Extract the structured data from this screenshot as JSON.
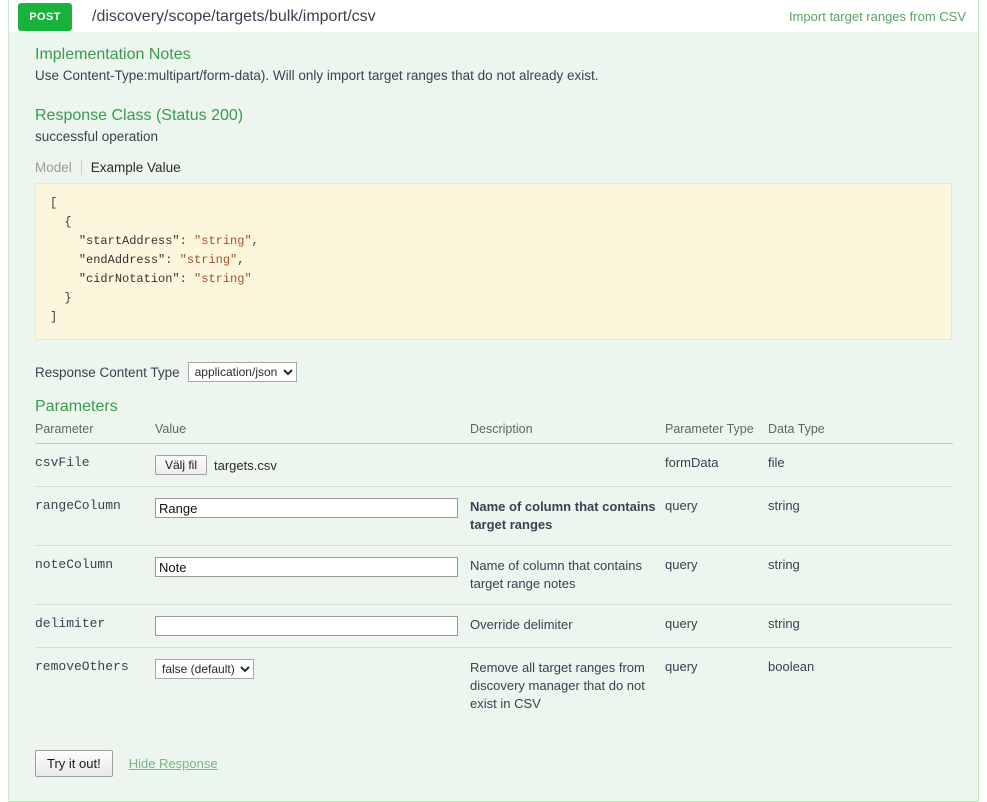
{
  "operation": {
    "method": "POST",
    "path": "/discovery/scope/targets/bulk/import/csv",
    "summary": "Import target ranges from CSV",
    "method_color": "#19b23c"
  },
  "notes": {
    "title": "Implementation Notes",
    "text": "Use Content-Type:multipart/form-data). Will only import target ranges that do not already exist."
  },
  "response_class": {
    "title": "Response Class (Status 200)",
    "description": "successful operation",
    "tabs": [
      {
        "label": "Model",
        "active": false
      },
      {
        "label": "Example Value",
        "active": true
      }
    ],
    "example_value": {
      "open_bracket": "[",
      "open_brace": "  {",
      "fields": [
        {
          "key": "\"startAddress\"",
          "value": "\"string\"",
          "comma": ","
        },
        {
          "key": "\"endAddress\"",
          "value": "\"string\"",
          "comma": ","
        },
        {
          "key": "\"cidrNotation\"",
          "value": "\"string\"",
          "comma": ""
        }
      ],
      "close_brace": "  }",
      "close_bracket": "]"
    }
  },
  "content_type": {
    "label": "Response Content Type",
    "selected": "application/json",
    "options": [
      "application/json"
    ]
  },
  "parameters": {
    "title": "Parameters",
    "columns": [
      "Parameter",
      "Value",
      "Description",
      "Parameter Type",
      "Data Type"
    ],
    "rows": [
      {
        "name": "csvFile",
        "control": "file",
        "file_button_label": "Välj fil",
        "file_name": "targets.csv",
        "value": "",
        "placeholder": "",
        "description": "",
        "required": false,
        "parameter_type": "formData",
        "data_type": "file"
      },
      {
        "name": "rangeColumn",
        "control": "text",
        "value": "Range",
        "placeholder": "",
        "description": "Name of column that contains target ranges",
        "required": true,
        "parameter_type": "query",
        "data_type": "string"
      },
      {
        "name": "noteColumn",
        "control": "text",
        "value": "Note",
        "placeholder": "",
        "description": "Name of column that contains target range notes",
        "required": false,
        "parameter_type": "query",
        "data_type": "string"
      },
      {
        "name": "delimiter",
        "control": "text",
        "value": "",
        "placeholder": "",
        "description": "Override delimiter",
        "required": false,
        "parameter_type": "query",
        "data_type": "string"
      },
      {
        "name": "removeOthers",
        "control": "select",
        "value": "false (default)",
        "options": [
          "false (default)",
          "true"
        ],
        "description": "Remove all target ranges from discovery manager that do not exist in CSV",
        "required": false,
        "parameter_type": "query",
        "data_type": "boolean"
      }
    ]
  },
  "footer": {
    "submit_label": "Try it out!",
    "hide_response_label": "Hide Response"
  }
}
